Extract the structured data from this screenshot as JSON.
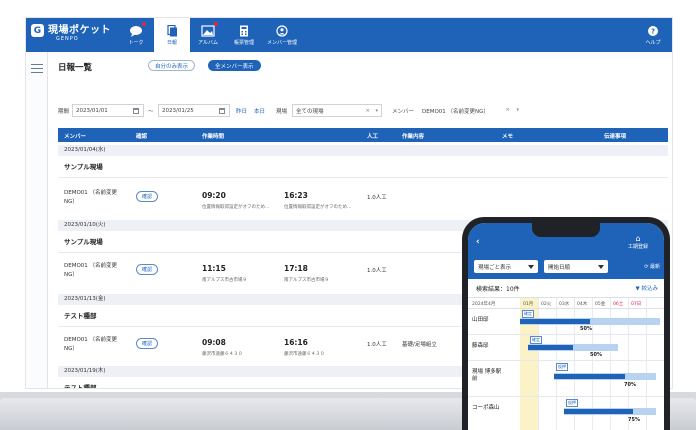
{
  "app": {
    "brand_name": "現場ポケット",
    "brand_sub": "GENPO",
    "brand_badge": "G"
  },
  "nav": {
    "items": [
      {
        "label": "トーク",
        "icon": "chat-icon"
      },
      {
        "label": "日報",
        "icon": "document-icon"
      },
      {
        "label": "アルバム",
        "icon": "album-icon"
      },
      {
        "label": "帳票管理",
        "icon": "calculator-icon"
      },
      {
        "label": "メンバー管理",
        "icon": "member-icon"
      }
    ],
    "help_label": "ヘルプ"
  },
  "page": {
    "title": "日報一覧",
    "toggle_self": "自分のみ表示",
    "toggle_all": "全メンバー表示"
  },
  "filters": {
    "period_label": "期間",
    "date_from": "2023/01/01",
    "range_sep": "〜",
    "date_to": "2023/01/25",
    "yesterday": "昨日",
    "today": "本日",
    "site_label": "現場",
    "site_value": "全ての現場",
    "member_label": "メンバー",
    "member_value": "DEMO01 （名前変更NG）"
  },
  "table": {
    "headers": [
      "メンバー",
      "確認",
      "作業時間",
      "人工",
      "作業内容",
      "メモ",
      "伝達事項"
    ],
    "groups": [
      {
        "date": "2023/01/04(水)",
        "site": "サンプル現場",
        "member": "DEMO01 （名前変更NG）",
        "confirm": "確認",
        "start": "09:20",
        "end": "16:23",
        "start_note": "位置情報取得設定がオフのため…",
        "end_note": "位置情報取得設定がオフのため…",
        "people": "1.0人工",
        "work": ""
      },
      {
        "date": "2023/01/10(火)",
        "site": "サンプル現場",
        "member": "DEMO01 （名前変更NG）",
        "confirm": "確認",
        "start": "11:15",
        "end": "17:18",
        "start_note": "南アルプス市古市場９",
        "end_note": "南アルプス市古市場９",
        "people": "1.0人工",
        "work": ""
      },
      {
        "date": "2023/01/13(金)",
        "site": "テスト種部",
        "member": "DEMO01 （名前変更NG）",
        "confirm": "確認",
        "start": "09:08",
        "end": "16:16",
        "start_note": "藤沢市遠藤６４３０",
        "end_note": "藤沢市遠藤６４３０",
        "people": "1.0人工",
        "work": "基礎/足場組立"
      },
      {
        "date": "2023/01/19(木)",
        "site": "テスト種部"
      }
    ]
  },
  "phone": {
    "back": "‹",
    "home_label": "工期登録",
    "dropdown_1": "現場ごと表示",
    "dropdown_2": "開始日順",
    "refresh_label": "最新",
    "result_count": "検索結果：10件",
    "filter_label": "絞込み",
    "month": "2024年4月",
    "days": [
      "01月",
      "02火",
      "03水",
      "04木",
      "05金",
      "06土",
      "07日"
    ],
    "rows": [
      {
        "name": "山田邸",
        "tag": "確定",
        "percent": 50
      },
      {
        "name": "藤森邸",
        "tag": "確定",
        "percent": 50
      },
      {
        "name": "現場 博多駅前",
        "tag": "仮押",
        "percent": 70
      },
      {
        "name": "コーポ森山",
        "tag": "仮押",
        "percent": 75
      }
    ]
  },
  "colors": {
    "brand_blue": "#1e63b8",
    "band_gray": "#edf0f4",
    "highlight_yellow": "#fbf2c8",
    "notify_red": "#e5234b"
  }
}
